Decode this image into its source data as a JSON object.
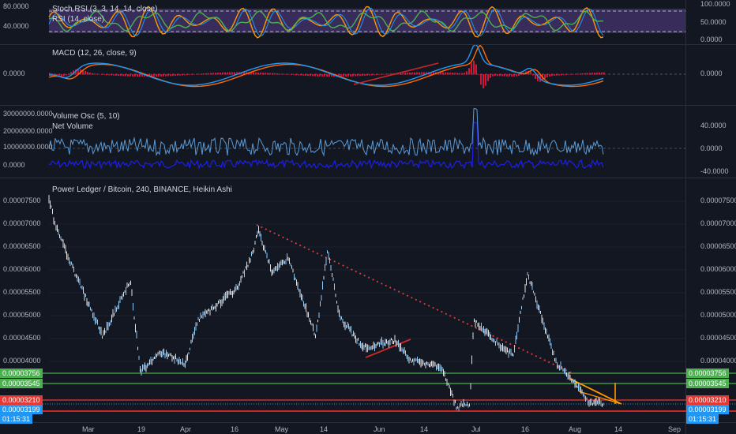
{
  "panes": {
    "rsi": {
      "titles": [
        "Stoch RSI (3, 3, 14, 14, close)",
        "RSI (14, close)"
      ],
      "left_ticks": [
        "80.0000",
        "40.0000"
      ],
      "right_ticks": [
        "100.0000",
        "50.0000",
        "0.0000"
      ]
    },
    "macd": {
      "title": "MACD (12, 26, close, 9)",
      "left_ticks": [
        "0.0000"
      ],
      "right_ticks": [
        "0.0000"
      ]
    },
    "volume": {
      "titles": [
        "Volume Osc (5, 10)",
        "Net Volume"
      ],
      "left_ticks": [
        "30000000.0000",
        "20000000.0000",
        "10000000.0000",
        "0.0000"
      ],
      "right_ticks": [
        "40.0000",
        "0.0000",
        "-40.0000"
      ]
    },
    "price": {
      "title": "Power Ledger / Bitcoin, 240, BINANCE, Heikin Ashi",
      "ticks": [
        "0.00007500",
        "0.00007000",
        "0.00006500",
        "0.00006000",
        "0.00005500",
        "0.00005000",
        "0.00004500",
        "0.00004000"
      ],
      "levels": {
        "upper_green": "0.00003756",
        "lower_green": "0.00003545",
        "red_level": "0.00003210",
        "current_price": "0.00003199",
        "time_left": "01:15:31"
      }
    }
  },
  "time_axis": [
    "Mar",
    "19",
    "Apr",
    "16",
    "May",
    "14",
    "Jun",
    "14",
    "Jul",
    "16",
    "Aug",
    "14",
    "Sep"
  ],
  "colors": {
    "background": "#131722",
    "grid": "#1e222d",
    "green_level": "#4caf50",
    "red_level": "#e53935",
    "blue_level": "#2196f3",
    "price_line": "#90caf9",
    "trend_dotted": "#e53935",
    "rsi_band": "#7e57c2",
    "stoch_k": "#ff9800",
    "rsi_line": "#4caf50",
    "macd_line": "#2196f3",
    "signal_line": "#ff6d00",
    "histogram": "#ff1744",
    "net_volume": "#1e1ee8",
    "volume_osc": "#5b9bd5"
  }
}
